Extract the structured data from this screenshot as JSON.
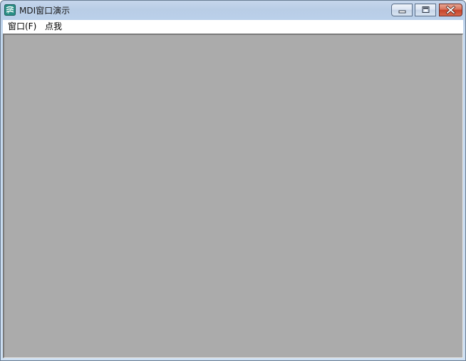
{
  "window": {
    "title": "MDI窗口演示",
    "icon": "app-icon",
    "buttons": {
      "minimize_icon": "minimize-icon",
      "maximize_icon": "maximize-icon",
      "close_icon": "close-icon"
    }
  },
  "menubar": {
    "items": [
      {
        "label": "窗口(F)"
      },
      {
        "label": "点我"
      }
    ]
  },
  "colors": {
    "mdi_background": "#ababab",
    "close_button": "#c5432a",
    "titlebar": "#bad0ea"
  }
}
